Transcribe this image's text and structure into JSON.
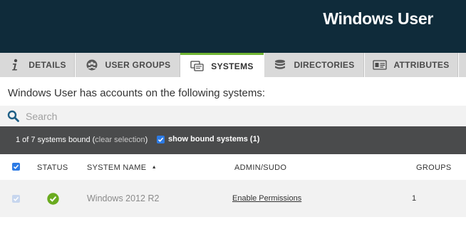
{
  "header": {
    "title": "Windows User"
  },
  "tabs": [
    {
      "label": "DETAILS",
      "icon": "info-icon"
    },
    {
      "label": "USER GROUPS",
      "icon": "user-groups-icon"
    },
    {
      "label": "SYSTEMS",
      "icon": "systems-icon",
      "active": true
    },
    {
      "label": "DIRECTORIES",
      "icon": "directories-icon"
    },
    {
      "label": "ATTRIBUTES",
      "icon": "attributes-icon"
    }
  ],
  "description": "Windows User has accounts on the following systems:",
  "search": {
    "placeholder": "Search",
    "value": ""
  },
  "bound_bar": {
    "count_text": "1 of 7 systems bound (",
    "clear_label": "clear selection",
    "close_paren": ")",
    "show_bound_label": "show bound systems (1)",
    "show_bound_checked": true
  },
  "table": {
    "columns": {
      "status": "STATUS",
      "system_name": "SYSTEM NAME",
      "sort_indicator": "▲",
      "admin": "ADMIN/SUDO",
      "groups": "GROUPS"
    },
    "header_checkbox_checked": true,
    "rows": [
      {
        "checked": true,
        "status": "online",
        "system_name": "Windows 2012 R2",
        "admin_link": "Enable Permissions",
        "groups": "1"
      }
    ]
  },
  "colors": {
    "header_bg": "#0f2b3a",
    "active_tab_accent": "#71b533",
    "checkbox_blue": "#2d7be5",
    "status_green": "#6aab1f",
    "bound_bar_bg": "#4a4b4c"
  }
}
